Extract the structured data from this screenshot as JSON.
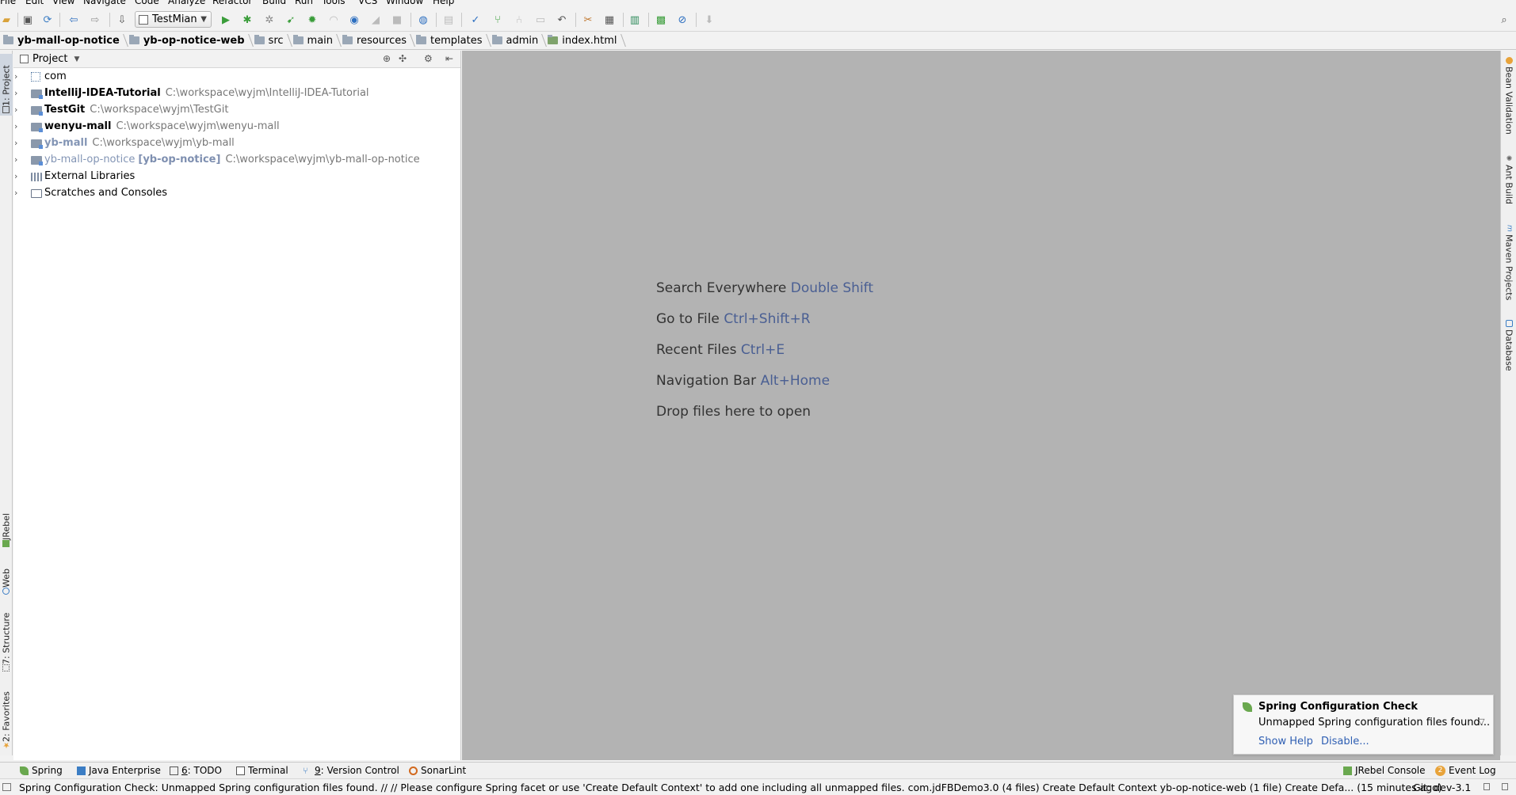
{
  "menu": [
    "File",
    "Edit",
    "View",
    "Navigate",
    "Code",
    "Analyze",
    "Refactor",
    "Build",
    "Run",
    "Tools",
    "VCS",
    "Window",
    "Help"
  ],
  "toolbar": {
    "run_config": "TestMian"
  },
  "breadcrumb": [
    "yb-mall-op-notice",
    "yb-op-notice-web",
    "src",
    "main",
    "resources",
    "templates",
    "admin",
    "index.html"
  ],
  "left_tabs": {
    "project": "1: Project",
    "jrebel": "JRebel",
    "web": "Web",
    "structure": "7: Structure",
    "favorites": "2: Favorites"
  },
  "right_tabs": {
    "bean": "Bean Validation",
    "ant": "Ant Build",
    "maven": "Maven Projects",
    "database": "Database"
  },
  "project_panel": {
    "title": "Project",
    "items": [
      {
        "name": "com",
        "path": "",
        "tag": ""
      },
      {
        "name": "IntelliJ-IDEA-Tutorial",
        "path": "C:\\workspace\\wyjm\\IntelliJ-IDEA-Tutorial",
        "tag": ""
      },
      {
        "name": "TestGit",
        "path": "C:\\workspace\\wyjm\\TestGit",
        "tag": ""
      },
      {
        "name": "wenyu-mall",
        "path": "C:\\workspace\\wyjm\\wenyu-mall",
        "tag": ""
      },
      {
        "name": "yb-mall",
        "path": "C:\\workspace\\wyjm\\yb-mall",
        "tag": ""
      },
      {
        "name": "yb-mall-op-notice",
        "path": "C:\\workspace\\wyjm\\yb-mall-op-notice",
        "tag": "[yb-op-notice]"
      },
      {
        "name": "External Libraries",
        "path": "",
        "tag": ""
      },
      {
        "name": "Scratches and Consoles",
        "path": "",
        "tag": ""
      }
    ]
  },
  "editor_hints": [
    {
      "text": "Search Everywhere",
      "key": "Double Shift"
    },
    {
      "text": "Go to File",
      "key": "Ctrl+Shift+R"
    },
    {
      "text": "Recent Files",
      "key": "Ctrl+E"
    },
    {
      "text": "Navigation Bar",
      "key": "Alt+Home"
    },
    {
      "text": "Drop files here to open",
      "key": ""
    }
  ],
  "notification": {
    "title": "Spring Configuration Check",
    "body": "Unmapped Spring configuration files found...",
    "show_help": "Show Help",
    "disable": "Disable..."
  },
  "bottom_tabs": {
    "spring": "Spring",
    "java_enterprise": "Java Enterprise",
    "todo_num": "6",
    "todo": ": TODO",
    "terminal": "Terminal",
    "vcs_num": "9",
    "vcs": ": Version Control",
    "sonarlint": "SonarLint",
    "jrebel_console": "JRebel Console",
    "event_badge": "2",
    "event_log": "Event Log"
  },
  "status_bar": {
    "message": "Spring Configuration Check: Unmapped Spring configuration files found. // // Please configure Spring facet or use 'Create Default Context' to add one including all unmapped files. com.jdFBDemo3.0 (4 files)   Create Default Context yb-op-notice-web (1 file)   Create Defa... (15 minutes ago)",
    "git": "Git: dev-3.1"
  },
  "colors": {
    "editor_bg": "#b3b3b3",
    "shortcut": "#4a5f93",
    "link": "#2f5fb3"
  }
}
